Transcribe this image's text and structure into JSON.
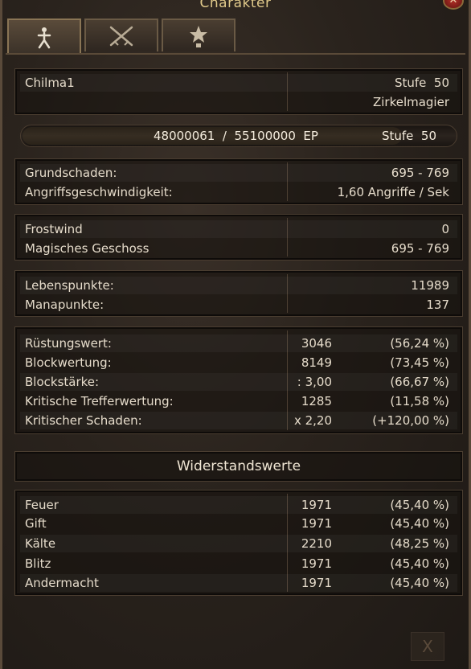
{
  "window": {
    "title": "Charakter",
    "close_label": "✕"
  },
  "tabs": [
    {
      "name": "character",
      "icon": "person-icon"
    },
    {
      "name": "combat",
      "icon": "crossed-swords-icon"
    },
    {
      "name": "honor",
      "icon": "star-trophy-icon"
    }
  ],
  "character": {
    "name": "Chilma1",
    "level_text": "Stufe",
    "level": "50",
    "class": "Zirkelmagier"
  },
  "experience": {
    "current": "48000061",
    "separator": "/",
    "max": "55100000",
    "unit": "EP",
    "level_label": "Stufe",
    "level": "50",
    "progress": 0.871
  },
  "base_stats": [
    {
      "label": "Grundschaden:",
      "value": "695  -  769"
    },
    {
      "label": "Angriffsgeschwindigkeit:",
      "value": "1,60  Angriffe  /  Sek"
    }
  ],
  "skills": [
    {
      "label": "Frostwind",
      "value": "0"
    },
    {
      "label": "Magisches  Geschoss",
      "value": "695  -  769"
    }
  ],
  "vitals": [
    {
      "label": "Lebenspunkte:",
      "value": "11989"
    },
    {
      "label": "Manapunkte:",
      "value": "137"
    }
  ],
  "defense": [
    {
      "label": "Rüstungswert:",
      "value": "3046",
      "pct": "(56,24  %)"
    },
    {
      "label": "Blockwertung:",
      "value": "8149",
      "pct": "(73,45  %)"
    },
    {
      "label": "Blockstärke:",
      "value": ":  3,00",
      "pct": "(66,67  %)"
    },
    {
      "label": "Kritische  Trefferwertung:",
      "value": "1285",
      "pct": "(11,58  %)"
    },
    {
      "label": "Kritischer  Schaden:",
      "value": "x  2,20",
      "pct": "(+120,00  %)"
    }
  ],
  "resist_header": "Widerstandswerte",
  "resistances": [
    {
      "label": "Feuer",
      "value": "1971",
      "pct": "(45,40  %)"
    },
    {
      "label": "Gift",
      "value": "1971",
      "pct": "(45,40  %)"
    },
    {
      "label": "Kälte",
      "value": "2210",
      "pct": "(48,25  %)"
    },
    {
      "label": "Blitz",
      "value": "1971",
      "pct": "(45,40  %)"
    },
    {
      "label": "Andermacht",
      "value": "1971",
      "pct": "(45,40  %)"
    }
  ]
}
